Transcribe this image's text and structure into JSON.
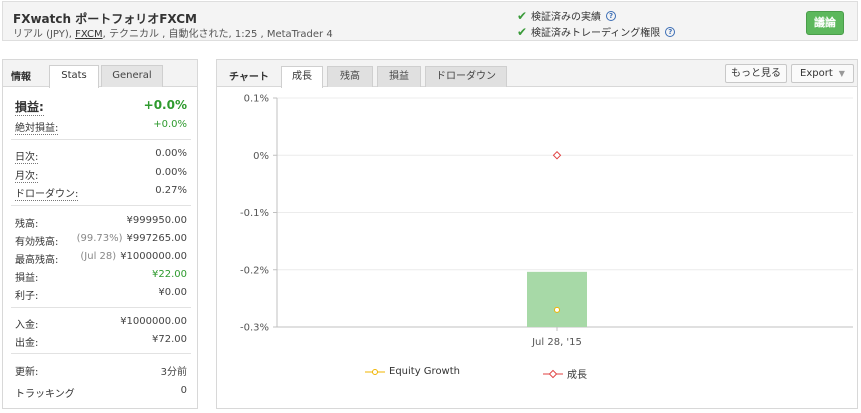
{
  "header": {
    "title": "FXwatch ポートフォリオFXCM",
    "subtitle_pre": "リアル (JPY), ",
    "subtitle_link": "FXCM",
    "subtitle_post": ", テクニカル , 自動化された, 1:25 , MetaTrader 4",
    "verified_track": "検証済みの実績",
    "verified_privileges": "検証済みトレーディング権限",
    "help_glyph": "?",
    "discuss_button": "議論"
  },
  "left": {
    "head": "情報",
    "tabs": [
      "Stats",
      "General"
    ],
    "stats": {
      "profit_label": "損益:",
      "profit_value": "+0.0%",
      "abs_profit_label": "絶対損益:",
      "abs_profit_value": "+0.0%",
      "daily_label": "日次:",
      "daily_value": "0.00%",
      "monthly_label": "月次:",
      "monthly_value": "0.00%",
      "drawdown_label": "ドローダウン:",
      "drawdown_value": "0.27%",
      "balance_label": "残高:",
      "balance_value": "¥999950.00",
      "equity_label": "有効残高:",
      "equity_pct": "(99.73%)",
      "equity_value": "¥997265.00",
      "highest_label": "最高残高:",
      "highest_date": "(Jul 28)",
      "highest_value": "¥1000000.00",
      "profit2_label": "損益:",
      "profit2_value": "¥22.00",
      "interest_label": "利子:",
      "interest_value": "¥0.00",
      "deposits_label": "入金:",
      "deposits_value": "¥1000000.00",
      "withdrawals_label": "出金:",
      "withdrawals_value": "¥72.00",
      "updated_label": "更新:",
      "updated_value": "3分前",
      "tracking_label": "トラッキング",
      "tracking_value": "0"
    }
  },
  "chart_panel": {
    "head": "チャート",
    "tabs": [
      "成長",
      "残高",
      "損益",
      "ドローダウン"
    ],
    "more_button": "もっと見る",
    "export_button": "Export",
    "export_arrow": "▼"
  },
  "chart_data": {
    "type": "bar",
    "categories": [
      "Jul 28, '15"
    ],
    "y_ticks": [
      "0.1%",
      "0%",
      "-0.1%",
      "-0.2%",
      "-0.3%"
    ],
    "y_tick_values": [
      0.1,
      0,
      -0.1,
      -0.2,
      -0.3
    ],
    "ylim": [
      -0.3,
      0.1
    ],
    "grid": true,
    "legend_placement": "bottom",
    "series": [
      {
        "name": "Equity Growth",
        "type": "bar",
        "values": [
          -0.27
        ],
        "color": "#a7d9a7",
        "marker_color": "#f0b400"
      },
      {
        "name": "成長",
        "type": "line",
        "values": [
          0.0
        ],
        "color": "#e04040"
      }
    ]
  }
}
